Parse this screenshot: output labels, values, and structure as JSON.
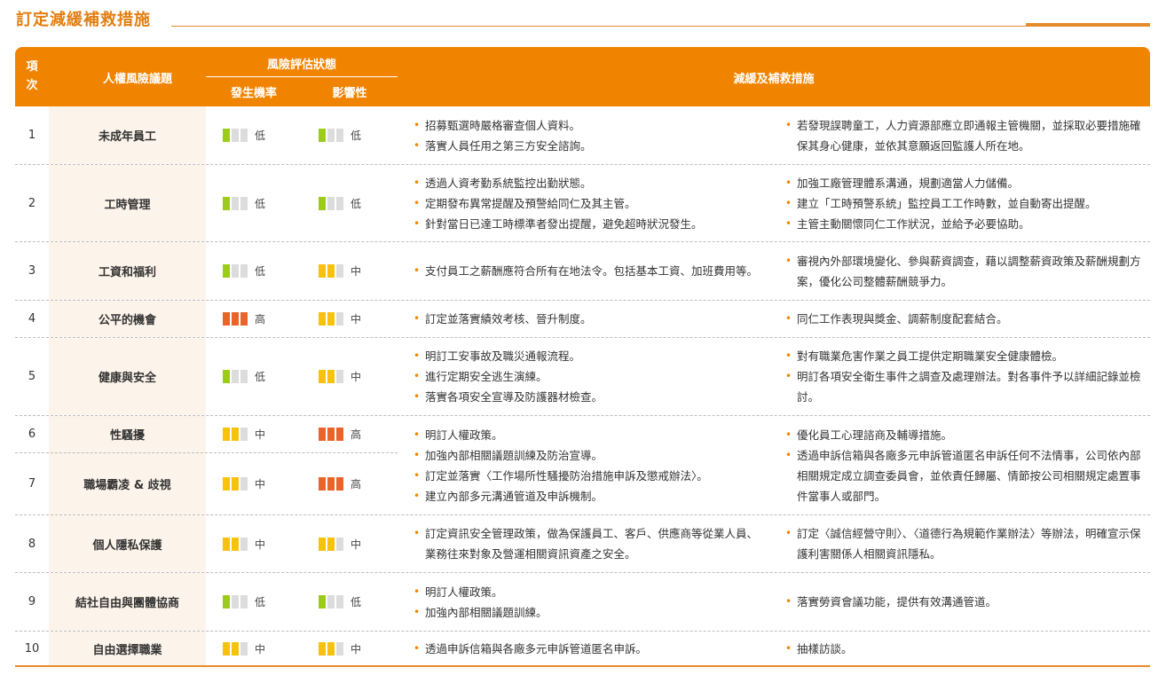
{
  "page": {
    "title": "訂定減緩補救措施"
  },
  "header": {
    "item": "項次",
    "issue": "人權風險議題",
    "risk_group": "風險評估狀態",
    "probability": "發生機率",
    "impact": "影響性",
    "measures": "減緩及補救措施"
  },
  "rows": [
    {
      "num": "1",
      "issue": "未成年員工",
      "prob": "低",
      "prob_level": "low",
      "impact": "低",
      "impact_level": "low",
      "left": [
        "招募甄選時嚴格審查個人資料。",
        "落實人員任用之第三方安全諮詢。"
      ],
      "right": [
        "若發現誤聘童工，人力資源部應立即通報主管機關，並採取必要措施確保其身心健康，並依其意願返回監護人所在地。"
      ]
    },
    {
      "num": "2",
      "issue": "工時管理",
      "prob": "低",
      "prob_level": "low",
      "impact": "低",
      "impact_level": "low",
      "left": [
        "透過人資考勤系統監控出勤狀態。",
        "定期發布異常提醒及預警給同仁及其主管。",
        "針對當日已達工時標準者發出提醒，避免超時狀況發生。"
      ],
      "right": [
        "加強工廠管理體系溝通，規劃適當人力儲備。",
        "建立「工時預警系統」監控員工工作時數，並自動寄出提醒。",
        "主管主動關懷同仁工作狀況，並給予必要協助。"
      ]
    },
    {
      "num": "3",
      "issue": "工資和福利",
      "prob": "低",
      "prob_level": "low",
      "impact": "中",
      "impact_level": "mid",
      "left": [
        "支付員工之薪酬應符合所有在地法令。包括基本工資、加班費用等。"
      ],
      "right": [
        "審視內外部環境變化、參與薪資調查，藉以調整薪資政策及薪酬規劃方案，優化公司整體薪酬競爭力。"
      ]
    },
    {
      "num": "4",
      "issue": "公平的機會",
      "prob": "高",
      "prob_level": "high",
      "impact": "中",
      "impact_level": "mid",
      "left": [
        "訂定並落實績效考核、晉升制度。"
      ],
      "right": [
        "同仁工作表現與獎金、調薪制度配套結合。"
      ]
    },
    {
      "num": "5",
      "issue": "健康與安全",
      "prob": "低",
      "prob_level": "low",
      "impact": "中",
      "impact_level": "mid",
      "left": [
        "明訂工安事故及職災通報流程。",
        "進行定期安全逃生演練。",
        "落實各項安全宣導及防護器材檢查。"
      ],
      "right": [
        "對有職業危害作業之員工提供定期職業安全健康體檢。",
        "明訂各項安全衛生事件之調查及處理辦法。對各事件予以詳細記錄並檢討。"
      ]
    },
    {
      "num": "6",
      "issue": "性騷擾",
      "prob": "中",
      "prob_level": "mid",
      "impact": "高",
      "impact_level": "high"
    },
    {
      "num": "7",
      "issue": "職場霸凌 & 歧視",
      "prob": "中",
      "prob_level": "mid",
      "impact": "高",
      "impact_level": "high"
    },
    {
      "num": "8",
      "issue": "個人隱私保護",
      "prob": "中",
      "prob_level": "mid",
      "impact": "中",
      "impact_level": "mid",
      "left": [
        "訂定資訊安全管理政策，做為保護員工、客戶、供應商等從業人員、業務往來對象及營運相關資訊資產之安全。"
      ],
      "right": [
        "訂定〈誠信經營守則〉、〈道德行為規範作業辦法〉等辦法，明確宣示保護利害關係人相關資訊隱私。"
      ]
    },
    {
      "num": "9",
      "issue": "結社自由與團體協商",
      "prob": "低",
      "prob_level": "low",
      "impact": "低",
      "impact_level": "low",
      "left": [
        "明訂人權政策。",
        "加強內部相關議題訓練。"
      ],
      "right": [
        "落實勞資會議功能，提供有效溝通管道。"
      ]
    },
    {
      "num": "10",
      "issue": "自由選擇職業",
      "prob": "中",
      "prob_level": "mid",
      "impact": "中",
      "impact_level": "mid",
      "left": [
        "透過申訴信箱與各廠多元申訴管道匿名申訴。"
      ],
      "right": [
        "抽樣訪談。"
      ]
    }
  ],
  "shared_6_7": {
    "left": [
      "明訂人權政策。",
      "加強內部相關議題訓練及防治宣導。",
      "訂定並落實〈工作場所性騷擾防治措施申訴及懲戒辦法〉。",
      "建立內部多元溝通管道及申訴機制。"
    ],
    "right": [
      "優化員工心理諮商及輔導措施。",
      "透過申訴信箱與各廠多元申訴管道匿名申訴任何不法情事，公司依內部相關規定成立調查委員會，並依責任歸屬、情節按公司相關規定處置事件當事人或部門。"
    ]
  }
}
